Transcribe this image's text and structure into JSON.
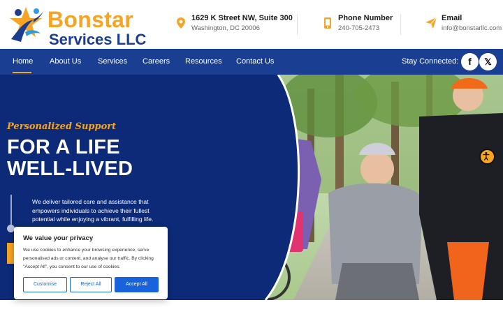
{
  "brand": {
    "line1": "Bonstar",
    "line2": "Services LLC",
    "colors": {
      "orange": "#f6a423",
      "navy": "#1a3e91",
      "dark_navy": "#0c2a78",
      "cookie_blue": "#1863dc"
    }
  },
  "contacts": [
    {
      "icon": "location-pin-icon",
      "title": "1629 K Street NW, Suite 300",
      "value": "Washington, DC 20006"
    },
    {
      "icon": "phone-icon",
      "title": "Phone Number",
      "value": "240-705-2473"
    },
    {
      "icon": "paper-plane-icon",
      "title": "Email",
      "value": "info@bonstarllc.com"
    }
  ],
  "nav": {
    "items": [
      "Home",
      "About Us",
      "Services",
      "Careers",
      "Resources",
      "Contact Us"
    ],
    "active": "Home",
    "stay_connected": "Stay Connected:",
    "social": [
      {
        "icon": "facebook-icon",
        "glyph": "f"
      },
      {
        "icon": "x-twitter-icon",
        "glyph": "𝕏"
      }
    ]
  },
  "hero": {
    "kicker": "Personalized Support",
    "headline_1": "FOR A LIFE",
    "headline_2": "WELL-LIVED",
    "description": "We deliver tailored care and assistance that empowers individuals to achieve their fullest potential while enjoying a vibrant, fulfilling life."
  },
  "cookie": {
    "title": "We value your privacy",
    "text": "We use cookies to enhance your browsing experience, serve personalised ads or content, and analyse our traffic. By clicking \"Accept All\", you consent to our use of cookies.",
    "customise": "Customise",
    "reject": "Reject All",
    "accept": "Accept All"
  }
}
